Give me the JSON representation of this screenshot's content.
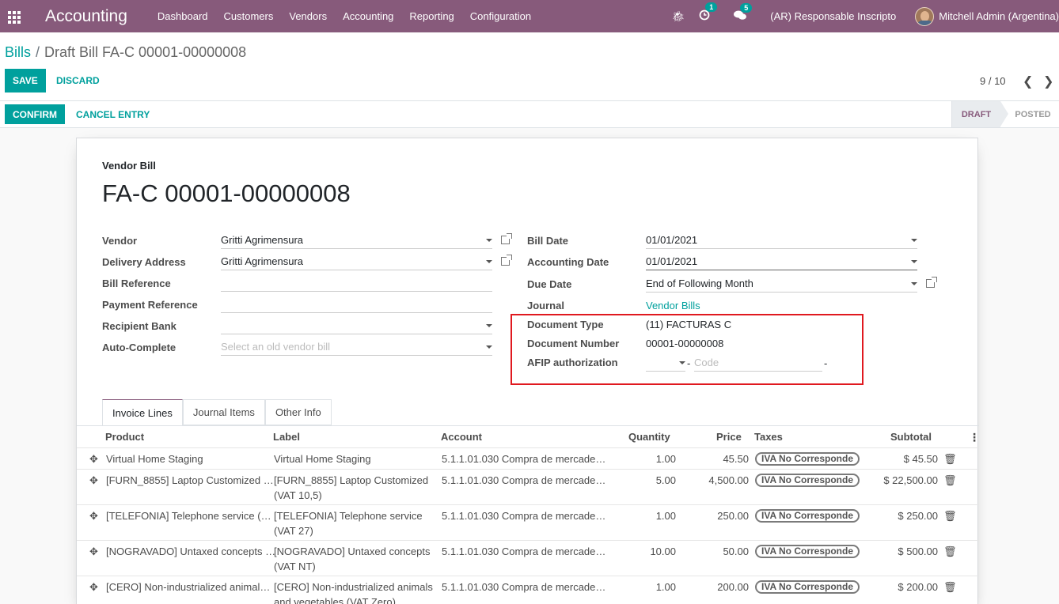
{
  "topbar": {
    "app_name": "Accounting",
    "menu": [
      "Dashboard",
      "Customers",
      "Vendors",
      "Accounting",
      "Reporting",
      "Configuration"
    ],
    "activity_count": "1",
    "messages_count": "5",
    "company": "(AR) Responsable Inscripto",
    "user": "Mitchell Admin (Argentina)"
  },
  "control_panel": {
    "breadcrumb_parent": "Bills",
    "breadcrumb_current": "Draft Bill FA-C 00001-00000008",
    "save_label": "SAVE",
    "discard_label": "DISCARD",
    "pager": "9 / 10"
  },
  "statusbar": {
    "confirm_label": "CONFIRM",
    "cancel_label": "CANCEL ENTRY",
    "stages": [
      "DRAFT",
      "POSTED"
    ],
    "current_stage": "DRAFT"
  },
  "form": {
    "doc_label": "Vendor Bill",
    "doc_title": "FA-C 00001-00000008",
    "left": {
      "vendor_label": "Vendor",
      "vendor_value": "Gritti Agrimensura",
      "delivery_label": "Delivery Address",
      "delivery_value": "Gritti Agrimensura",
      "bill_ref_label": "Bill Reference",
      "bill_ref_value": "",
      "payment_ref_label": "Payment Reference",
      "payment_ref_value": "",
      "recipient_bank_label": "Recipient Bank",
      "recipient_bank_value": "",
      "autocomplete_label": "Auto-Complete",
      "autocomplete_placeholder": "Select an old vendor bill"
    },
    "right": {
      "bill_date_label": "Bill Date",
      "bill_date_value": "01/01/2021",
      "accounting_date_label": "Accounting Date",
      "accounting_date_value": "01/01/2021",
      "due_date_label": "Due Date",
      "due_date_value": "End of Following Month",
      "journal_label": "Journal",
      "journal_value": "Vendor Bills",
      "doc_type_label": "Document Type",
      "doc_type_value": "(11) FACTURAS C",
      "doc_number_label": "Document Number",
      "doc_number_value": "00001-00000008",
      "afip_label": "AFIP authorization",
      "afip_code_placeholder": "Code",
      "afip_sep1": "-",
      "afip_sep2": "-"
    }
  },
  "tabs": [
    "Invoice Lines",
    "Journal Items",
    "Other Info"
  ],
  "active_tab": "Invoice Lines",
  "table": {
    "headers": {
      "product": "Product",
      "label": "Label",
      "account": "Account",
      "quantity": "Quantity",
      "price": "Price",
      "taxes": "Taxes",
      "subtotal": "Subtotal"
    },
    "rows": [
      {
        "product": "Virtual Home Staging",
        "label1": "Virtual Home Staging",
        "label2": "",
        "account": "5.1.1.01.030 Compra de mercade…",
        "quantity": "1.00",
        "price": "45.50",
        "tax": "IVA No Corresponde",
        "subtotal": "$ 45.50"
      },
      {
        "product": "[FURN_8855] Laptop Customized …",
        "label1": "[FURN_8855] Laptop Customized",
        "label2": "(VAT 10,5)",
        "account": "5.1.1.01.030 Compra de mercade…",
        "quantity": "5.00",
        "price": "4,500.00",
        "tax": "IVA No Corresponde",
        "subtotal": "$ 22,500.00"
      },
      {
        "product": "[TELEFONIA] Telephone service (…",
        "label1": "[TELEFONIA] Telephone service",
        "label2": "(VAT 27)",
        "account": "5.1.1.01.030 Compra de mercade…",
        "quantity": "1.00",
        "price": "250.00",
        "tax": "IVA No Corresponde",
        "subtotal": "$ 250.00"
      },
      {
        "product": "[NOGRAVADO] Untaxed concepts …",
        "label1": "[NOGRAVADO] Untaxed concepts",
        "label2": "(VAT NT)",
        "account": "5.1.1.01.030 Compra de mercade…",
        "quantity": "10.00",
        "price": "50.00",
        "tax": "IVA No Corresponde",
        "subtotal": "$ 500.00"
      },
      {
        "product": "[CERO] Non-industrialized animal…",
        "label1": "[CERO] Non-industrialized animals",
        "label2": "and vegetables (VAT Zero)",
        "account": "5.1.1.01.030 Compra de mercade…",
        "quantity": "1.00",
        "price": "200.00",
        "tax": "IVA No Corresponde",
        "subtotal": "$ 200.00"
      }
    ]
  },
  "colors": {
    "brand": "#875a7b",
    "accent": "#00a09d",
    "highlight_box": "#e0191f"
  }
}
